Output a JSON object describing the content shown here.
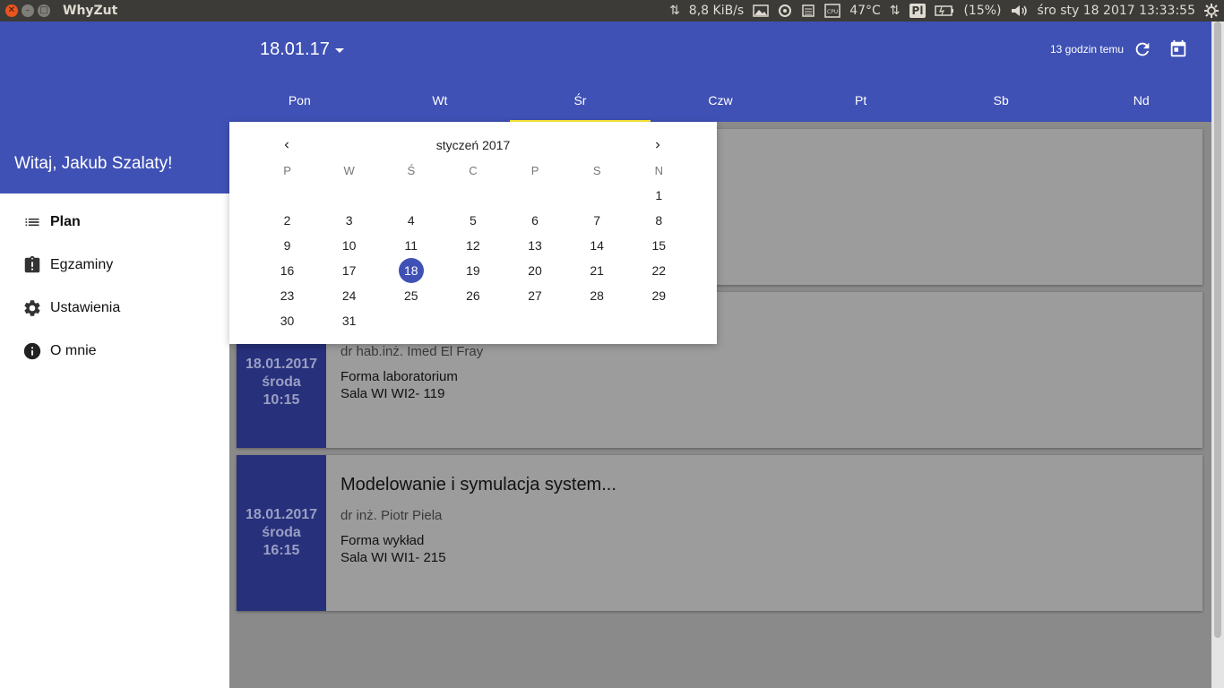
{
  "window": {
    "title": "WhyZut",
    "tray": {
      "net_speed": "8,8 KiB/s",
      "cpu_temp": "47°C",
      "kbd_layout": "Pl",
      "battery": "(15%)",
      "clock": "śro sty 18 2017 13:33:55"
    }
  },
  "header": {
    "selected_date": "18.01.17",
    "sync_status": "13 godzin temu",
    "days": [
      "Pon",
      "Wt",
      "Śr",
      "Czw",
      "Pt",
      "Sb",
      "Nd"
    ],
    "active_day": "Śr",
    "accent": "#3f51b5",
    "indicator": "#ffeb3b"
  },
  "drawer": {
    "greeting": "Witaj, Jakub Szalaty!",
    "items": [
      {
        "label": "Plan",
        "icon": "list-icon"
      },
      {
        "label": "Egzaminy",
        "icon": "clipboard-alert-icon"
      },
      {
        "label": "Ustawienia",
        "icon": "gear-icon"
      },
      {
        "label": "O mnie",
        "icon": "info-icon"
      }
    ]
  },
  "datepicker": {
    "month_title": "styczeń 2017",
    "weekdays": [
      "P",
      "W",
      "Ś",
      "C",
      "P",
      "S",
      "N"
    ],
    "weeks": [
      [
        "",
        "",
        "",
        "",
        "",
        "",
        "1"
      ],
      [
        "2",
        "3",
        "4",
        "5",
        "6",
        "7",
        "8"
      ],
      [
        "9",
        "10",
        "11",
        "12",
        "13",
        "14",
        "15"
      ],
      [
        "16",
        "17",
        "18",
        "19",
        "20",
        "21",
        "22"
      ],
      [
        "23",
        "24",
        "25",
        "26",
        "27",
        "28",
        "29"
      ],
      [
        "30",
        "31",
        "",
        "",
        "",
        "",
        ""
      ]
    ],
    "selected_day": "18"
  },
  "classes": [
    {
      "date": "18.01.2017",
      "weekday": "środa",
      "time": "10:15",
      "title": "",
      "teacher": "dr hab.inż. Imed El Fray",
      "form": "Forma laboratorium",
      "room": "Sala WI WI2- 119"
    },
    {
      "date": "18.01.2017",
      "weekday": "środa",
      "time": "16:15",
      "title": "Modelowanie i symulacja system...",
      "teacher": "dr inż. Piotr Piela",
      "form": "Forma wykład",
      "room": "Sala WI WI1- 215"
    }
  ]
}
